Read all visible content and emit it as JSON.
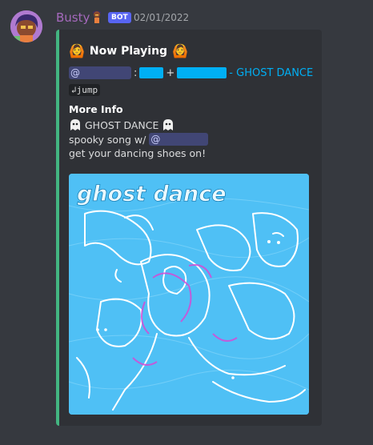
{
  "message": {
    "username": "Busty",
    "bot_badge": "BOT",
    "timestamp": "02/01/2022",
    "colors": {
      "username": "#a569bd",
      "badge": "#5865f2",
      "embed_bar": "#43b581",
      "link": "#00aff4"
    }
  },
  "embed": {
    "title": "Now Playing",
    "title_emoji": "woman-gesturing-ok-emoji",
    "line1": {
      "mention_prefix": "@",
      "colon": ":",
      "plus": "+",
      "song_link": "- GHOST DANCE"
    },
    "jump_label": "↲jump",
    "field": {
      "name": "More Info",
      "line1": "GHOST DANCE",
      "line2_prefix": "spooky song w/",
      "line2_mention": "@",
      "line3": "get your dancing shoes on!"
    },
    "image_caption": "ghost dance"
  }
}
